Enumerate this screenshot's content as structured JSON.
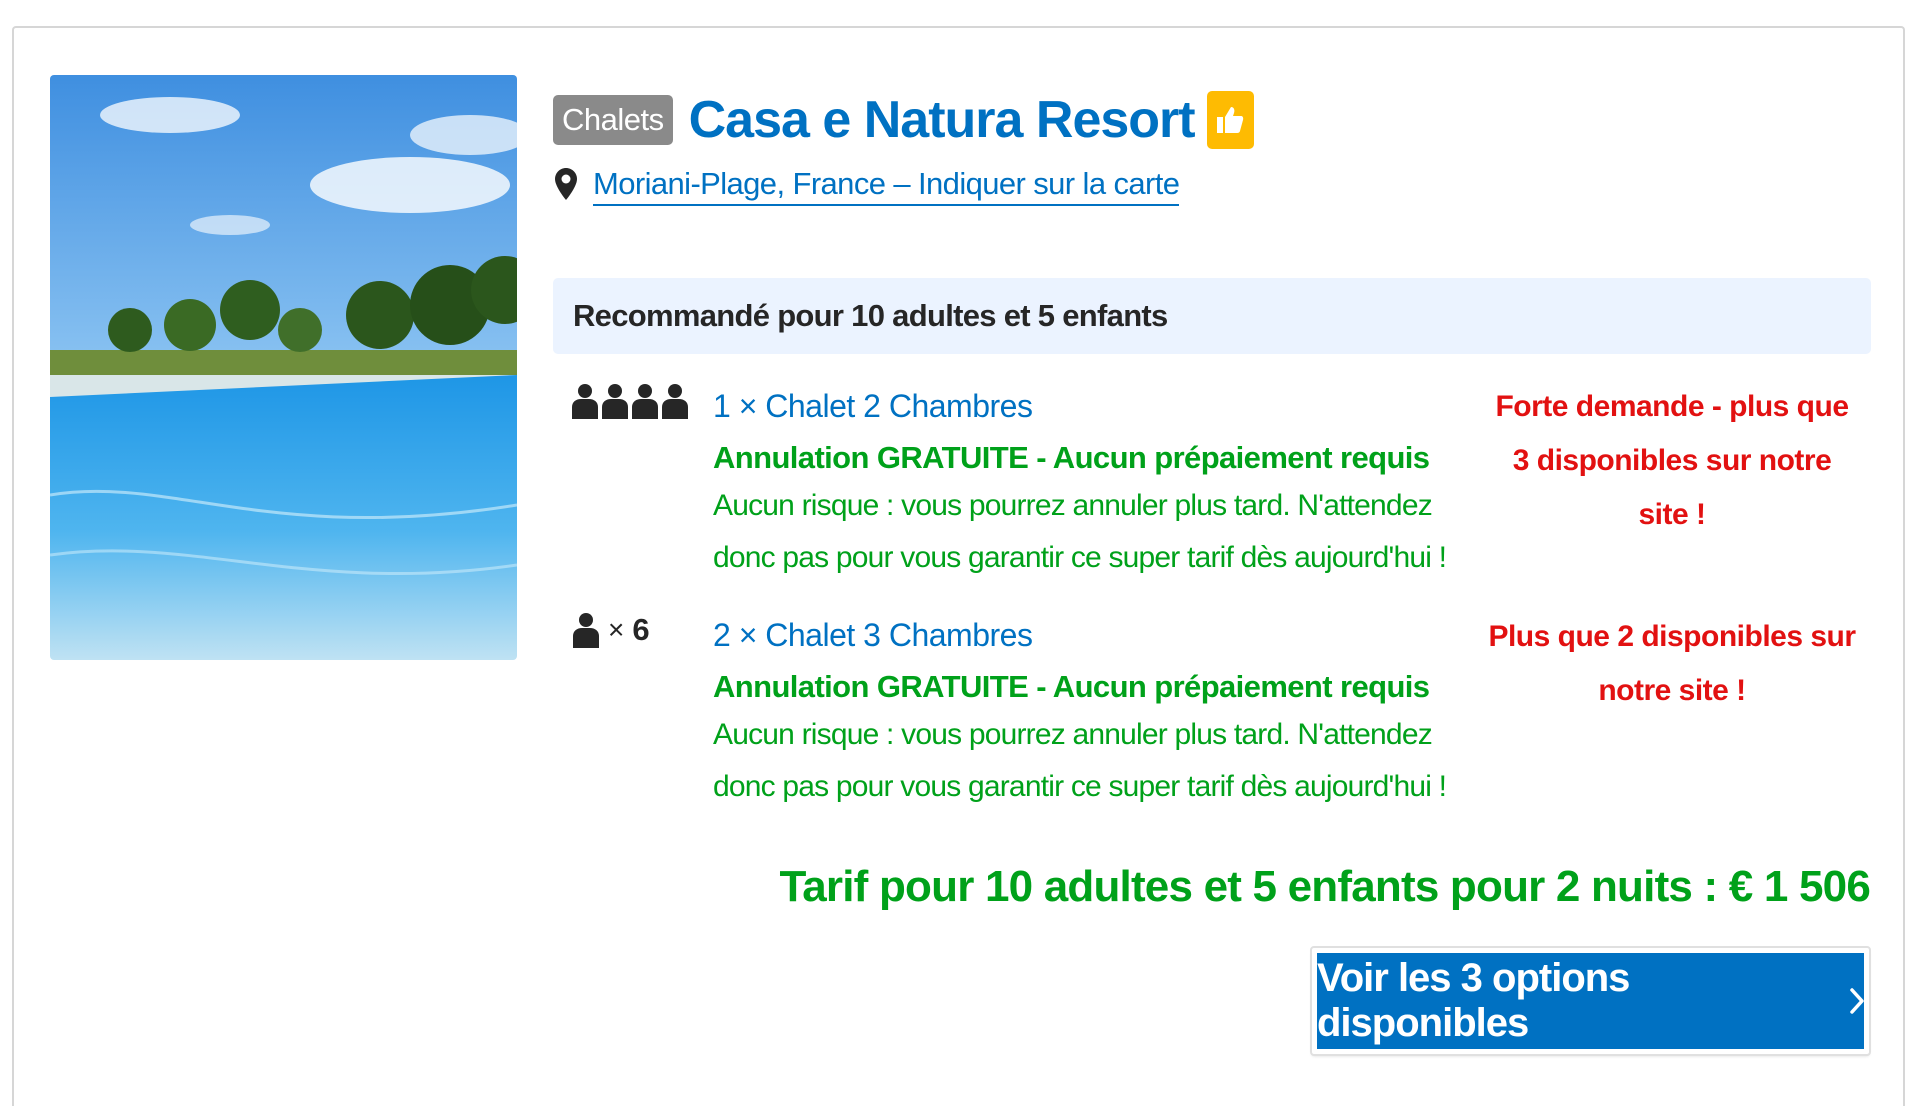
{
  "property": {
    "type_badge": "Chalets",
    "name": "Casa e Natura Resort",
    "location_text": "Moriani-Plage, France – Indiquer sur la carte"
  },
  "recommendation": {
    "title": "Recommandé pour 10 adultes et 5 enfants"
  },
  "rooms": [
    {
      "name": "1 × Chalet 2 Chambres",
      "occupancy_icons": 4,
      "cancellation": "Annulation GRATUITE - Aucun prépaiement requis",
      "description_line1": "Aucun risque : vous pourrez annuler plus tard. N'attendez",
      "description_line2": "donc pas pour vous garantir ce super tarif dès aujourd'hui !",
      "scarcity_lines": [
        "Forte demande - plus que",
        "3 disponibles sur notre",
        "site !"
      ]
    },
    {
      "name": "2 × Chalet 3 Chambres",
      "occupancy_times": "×",
      "occupancy_count": "6",
      "cancellation": "Annulation GRATUITE - Aucun prépaiement requis",
      "description_line1": "Aucun risque : vous pourrez annuler plus tard. N'attendez",
      "description_line2": "donc pas pour vous garantir ce super tarif dès aujourd'hui !",
      "scarcity_lines": [
        "Plus que 2 disponibles sur",
        "notre site !"
      ]
    }
  ],
  "price_text": "Tarif pour 10 adultes et 5 enfants pour 2 nuits : € 1 506",
  "cta_label": "Voir les 3 options disponibles",
  "colors": {
    "link_blue": "#0071c2",
    "success_green": "#00a11a",
    "urgency_red": "#e21111",
    "badge_gray": "#8a8a8a",
    "thumb_yellow": "#febb02",
    "reco_bg": "#ebf3ff"
  }
}
